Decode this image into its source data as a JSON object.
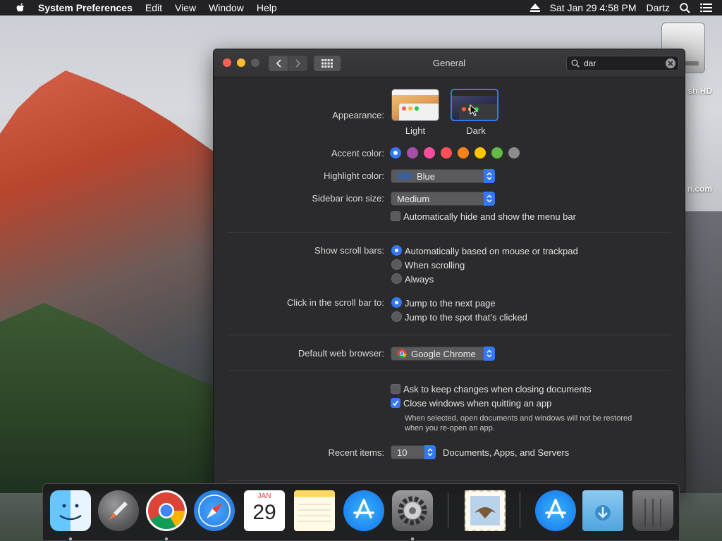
{
  "menubar": {
    "app_name": "System Preferences",
    "menus": [
      "Edit",
      "View",
      "Window",
      "Help"
    ],
    "datetime": "Sat Jan 29  4:58 PM",
    "user": "Dartz"
  },
  "desktop": {
    "label_1": "sh HD",
    "label_2": "n.com"
  },
  "window": {
    "title": "General",
    "search_value": "dar"
  },
  "appearance": {
    "label": "Appearance:",
    "options": [
      "Light",
      "Dark"
    ],
    "selected": "Dark"
  },
  "accent": {
    "label": "Accent color:",
    "colors": [
      "#3478f6",
      "#a550a7",
      "#f74f9e",
      "#ff5257",
      "#f7821b",
      "#ffc600",
      "#62ba46",
      "#8c8c8c"
    ],
    "selected_index": 0
  },
  "highlight": {
    "label": "Highlight color:",
    "value": "Blue"
  },
  "sidebar_icon": {
    "label": "Sidebar icon size:",
    "value": "Medium"
  },
  "menubar_hide": {
    "label": "Automatically hide and show the menu bar",
    "checked": false
  },
  "scrollbars": {
    "label": "Show scroll bars:",
    "options": [
      "Automatically based on mouse or trackpad",
      "When scrolling",
      "Always"
    ],
    "selected_index": 0
  },
  "click_scroll": {
    "label": "Click in the scroll bar to:",
    "options": [
      "Jump to the next page",
      "Jump to the spot that’s clicked"
    ],
    "selected_index": 0
  },
  "browser": {
    "label": "Default web browser:",
    "value": "Google Chrome"
  },
  "docs": {
    "ask_keep": "Ask to keep changes when closing documents",
    "close_windows": "Close windows when quitting an app",
    "note_line1": "When selected, open documents and windows will not be restored",
    "note_line2": "when you re-open an app."
  },
  "recent": {
    "label": "Recent items:",
    "value": "10",
    "suffix": "Documents, Apps, and Servers"
  },
  "dock": {
    "calendar_month": "JAN",
    "calendar_day": "29"
  }
}
